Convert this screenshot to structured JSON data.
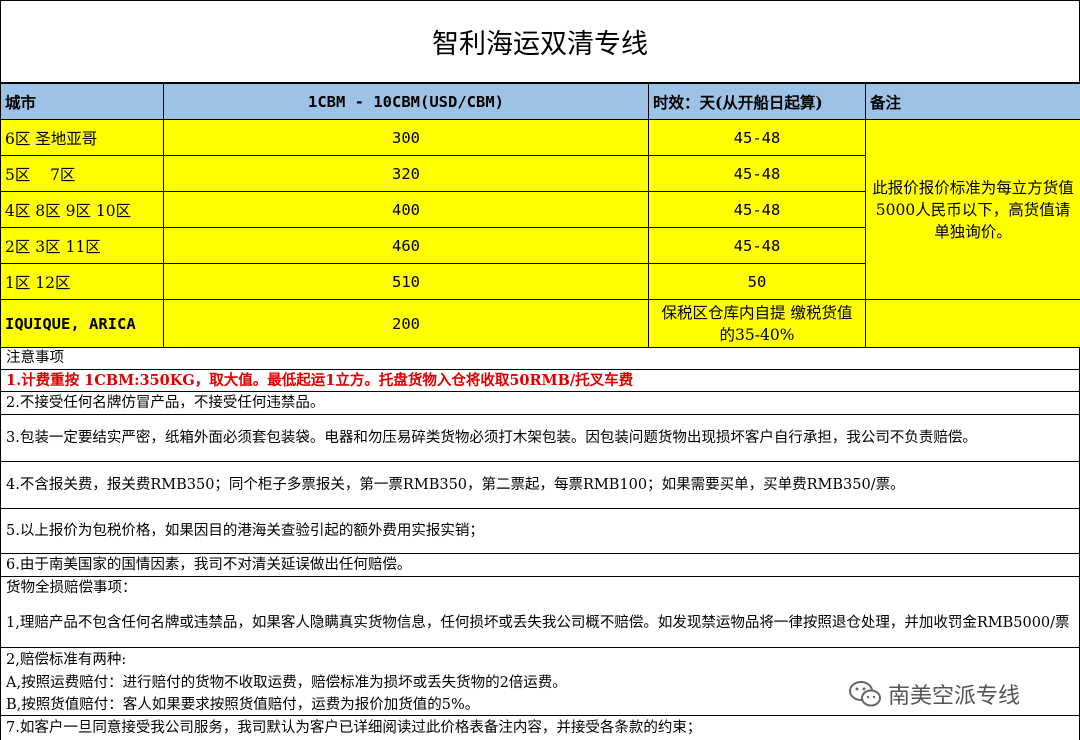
{
  "title": "智利海运双清专线",
  "table": {
    "headers": {
      "city": "城市",
      "price": "1CBM - 10CBM(USD/CBM)",
      "time": "时效：天(从开船日起算)",
      "remark": "备注"
    },
    "rows": [
      {
        "city": "6区 圣地亚哥",
        "price": "300",
        "time": "45-48"
      },
      {
        "city": "5区    7区",
        "price": "320",
        "time": "45-48"
      },
      {
        "city": "4区 8区 9区 10区",
        "price": "400",
        "time": "45-48"
      },
      {
        "city": "2区 3区 11区",
        "price": "460",
        "time": "45-48"
      },
      {
        "city": "1区 12区",
        "price": "510",
        "time": "50"
      },
      {
        "city": "IQUIQUE, ARICA",
        "price": "200",
        "time": "保税区仓库内自提  缴税货值的35-40%"
      }
    ],
    "remark_text": "此报价报价标准为每立方货值5000人民币以下，高货值请单独询价。"
  },
  "notes": {
    "heading": "注意事项",
    "n1": "1.计费重按 1CBM:350KG，取大值。最低起运1立方。托盘货物入仓将收取50RMB/托叉车费",
    "n2": "2.不接受任何名牌仿冒产品，不接受任何违禁品。",
    "n3": "3.包装一定要结实严密，纸箱外面必须套包装袋。电器和勿压易碎类货物必须打木架包装。因包装问题货物出现损坏客户自行承担，我公司不负责赔偿。",
    "n4": "4.不含报关费，报关费RMB350；同个柜子多票报关，第一票RMB350，第二票起，每票RMB100；如果需要买单，买单费RMB350/票。",
    "n5": "5.以上报价为包税价格，如果因目的港海关查验引起的额外费用实报实销；",
    "n6": "6.由于南美国家的国情因素，我司不对清关延误做出任何赔偿。",
    "loss_heading": "货物全损赔偿事项：",
    "l1": " 1,理赔产品不包含任何名牌或违禁品，如果客人隐瞒真实货物信息，任何损坏或丢失我公司概不赔偿。如发现禁运物品将一律按照退仓处理，并加收罚金RMB5000/票",
    "l2": " 2,赔偿标准有两种:",
    "la": "A,按照运费赔付：进行赔付的货物不收取运费，赔偿标准为损坏或丢失货物的2倍运费。",
    "lb": "B,按照货值赔付：客人如果要求按照货值赔付，运费为报价加货值的5%。",
    "n7": "7.如客户一旦同意接受我公司服务，我司默认为客户已详细阅读过此价格表备注内容，并接受各条款的约束；"
  },
  "watermark": "南美空派专线"
}
